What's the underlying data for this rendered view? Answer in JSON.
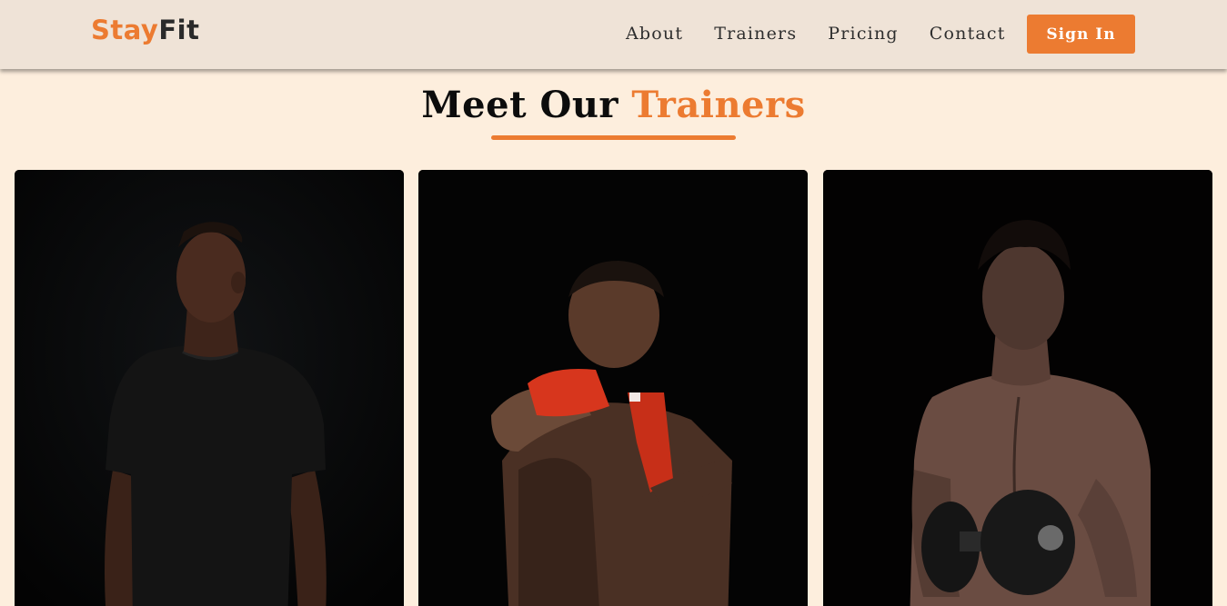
{
  "header": {
    "logo_part1": "Stay",
    "logo_part2": "Fit",
    "nav": [
      "About",
      "Trainers",
      "Pricing",
      "Contact"
    ],
    "signin_label": "Sign In"
  },
  "section": {
    "title_part1": "Meet Our",
    "title_part2": "Trainers"
  },
  "colors": {
    "accent": "#ec7b31",
    "background": "#fdeedd",
    "header_bg": "#efe3d7"
  },
  "cards": [
    {
      "image": "trainer-black-shirt-photo"
    },
    {
      "image": "trainer-boxing-photo"
    },
    {
      "image": "trainer-dumbbell-photo"
    }
  ]
}
